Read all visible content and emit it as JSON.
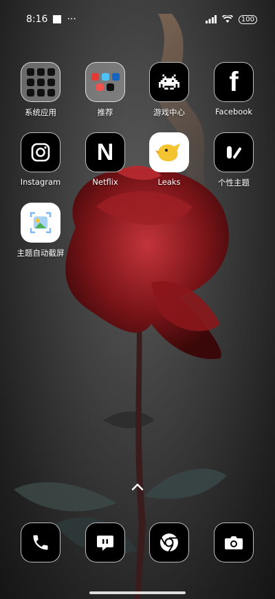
{
  "status": {
    "time": "8:16",
    "dots": "···",
    "battery": "100"
  },
  "apps": [
    {
      "label": "系统应用"
    },
    {
      "label": "推荐"
    },
    {
      "label": "游戏中心"
    },
    {
      "label": "Facebook"
    },
    {
      "label": "Instagram"
    },
    {
      "label": "Netflix"
    },
    {
      "label": "Leaks"
    },
    {
      "label": "个性主题"
    },
    {
      "label": "主题自动截屏"
    }
  ],
  "icons": {
    "netflix": "N",
    "facebook": "f"
  },
  "dock": [
    {
      "icon": "phone-icon"
    },
    {
      "icon": "message-icon"
    },
    {
      "icon": "chrome-icon"
    },
    {
      "icon": "camera-icon"
    }
  ]
}
